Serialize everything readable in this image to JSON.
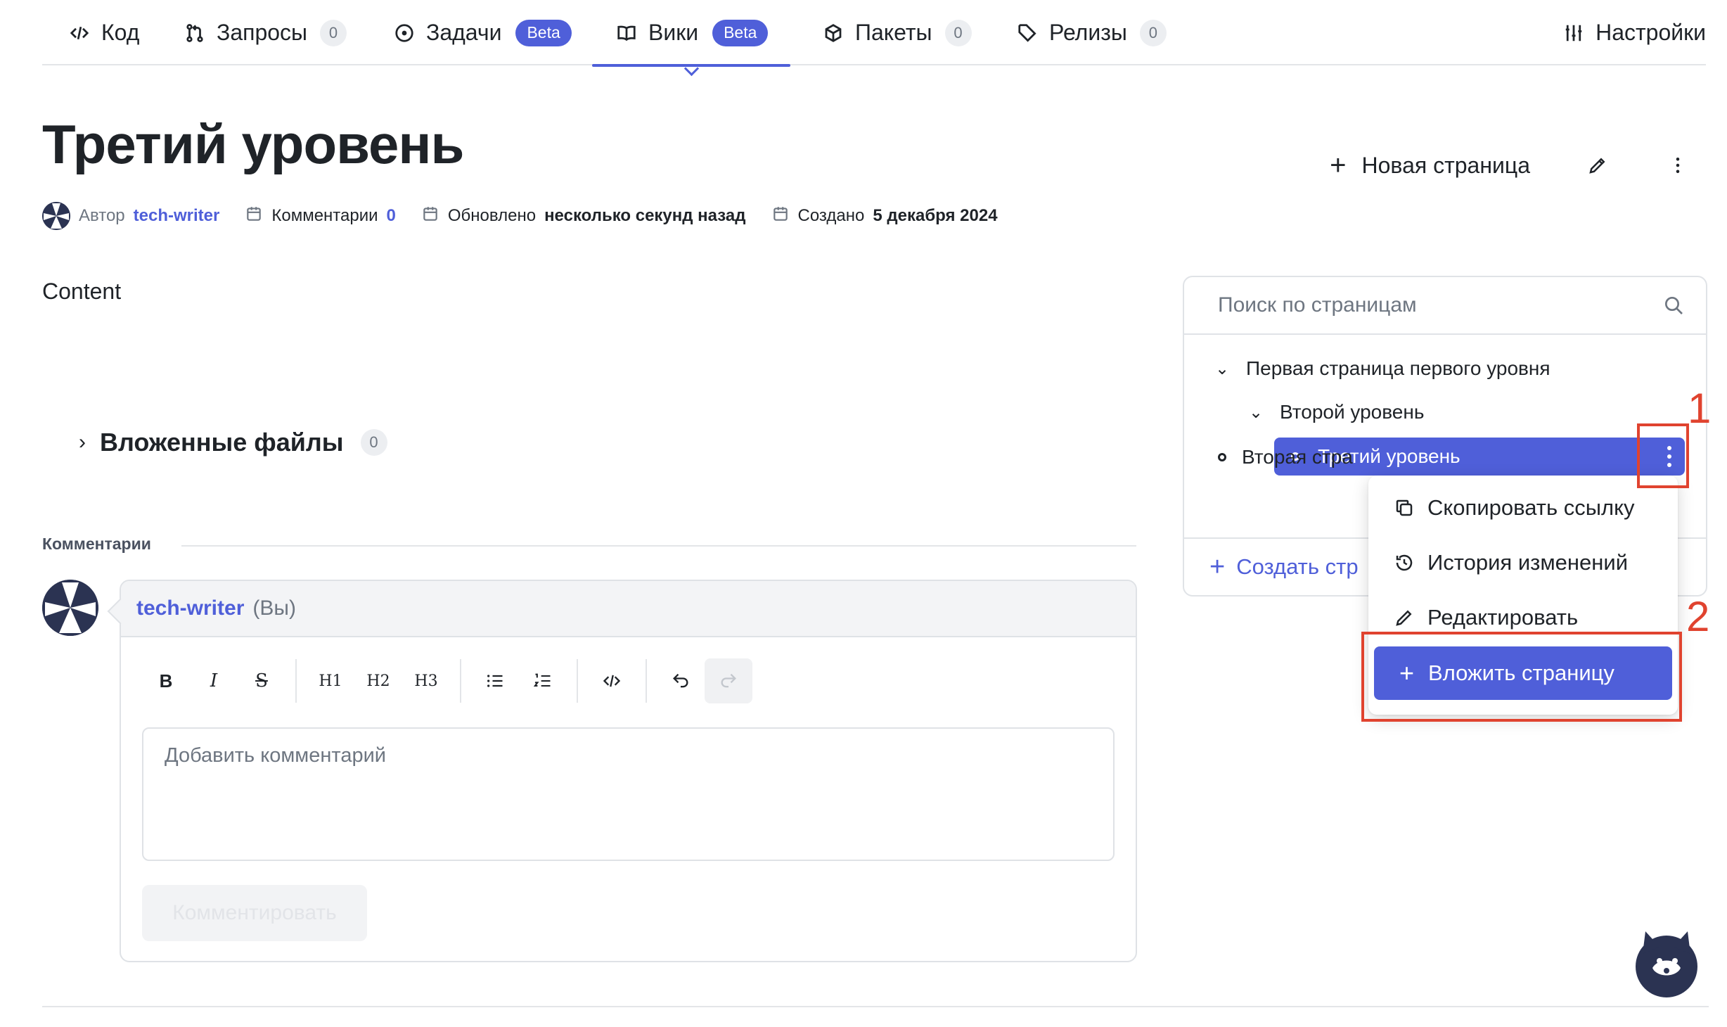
{
  "nav": {
    "tabs": [
      {
        "label": "Код"
      },
      {
        "label": "Запросы",
        "count": "0"
      },
      {
        "label": "Задачи",
        "badge": "Beta"
      },
      {
        "label": "Вики",
        "badge": "Beta"
      },
      {
        "label": "Пакеты",
        "count": "0"
      },
      {
        "label": "Релизы",
        "count": "0"
      }
    ],
    "settings": "Настройки"
  },
  "page": {
    "title": "Третий уровень",
    "new_page": "Новая страница",
    "content": "Content"
  },
  "meta": {
    "author_label": "Автор",
    "author": "tech-writer",
    "comments_label": "Комментарии",
    "comments_count": "0",
    "updated_label": "Обновлено",
    "updated_value": "несколько секунд назад",
    "created_label": "Создано",
    "created_value": "5 декабря 2024"
  },
  "attachments": {
    "label": "Вложенные файлы",
    "count": "0"
  },
  "comments": {
    "heading": "Комментарии",
    "user": "tech-writer",
    "you": "(Вы)",
    "toolbar": [
      "B",
      "I",
      "S",
      "H1",
      "H2",
      "H3"
    ],
    "placeholder": "Добавить комментарий",
    "submit": "Комментировать"
  },
  "sidebar": {
    "search_placeholder": "Поиск по страницам",
    "tree": [
      {
        "label": "Первая страница первого уровня"
      },
      {
        "label": "Второй уровень"
      },
      {
        "label": "Третий уровень"
      },
      {
        "label": "Вторая стра"
      }
    ],
    "create_label": "Создать стр"
  },
  "context_menu": {
    "items": [
      {
        "label": "Скопировать ссылку",
        "icon": "copy-icon"
      },
      {
        "label": "История изменений",
        "icon": "history-icon"
      },
      {
        "label": "Редактировать",
        "icon": "pencil-icon"
      },
      {
        "label": "Вложить страницу",
        "icon": "plus-icon"
      }
    ]
  },
  "annotations": [
    "1",
    "2"
  ],
  "colors": {
    "accent": "#4f5fd9",
    "callout": "#e0432f",
    "text": "#1f2328",
    "muted": "#6e7681"
  }
}
